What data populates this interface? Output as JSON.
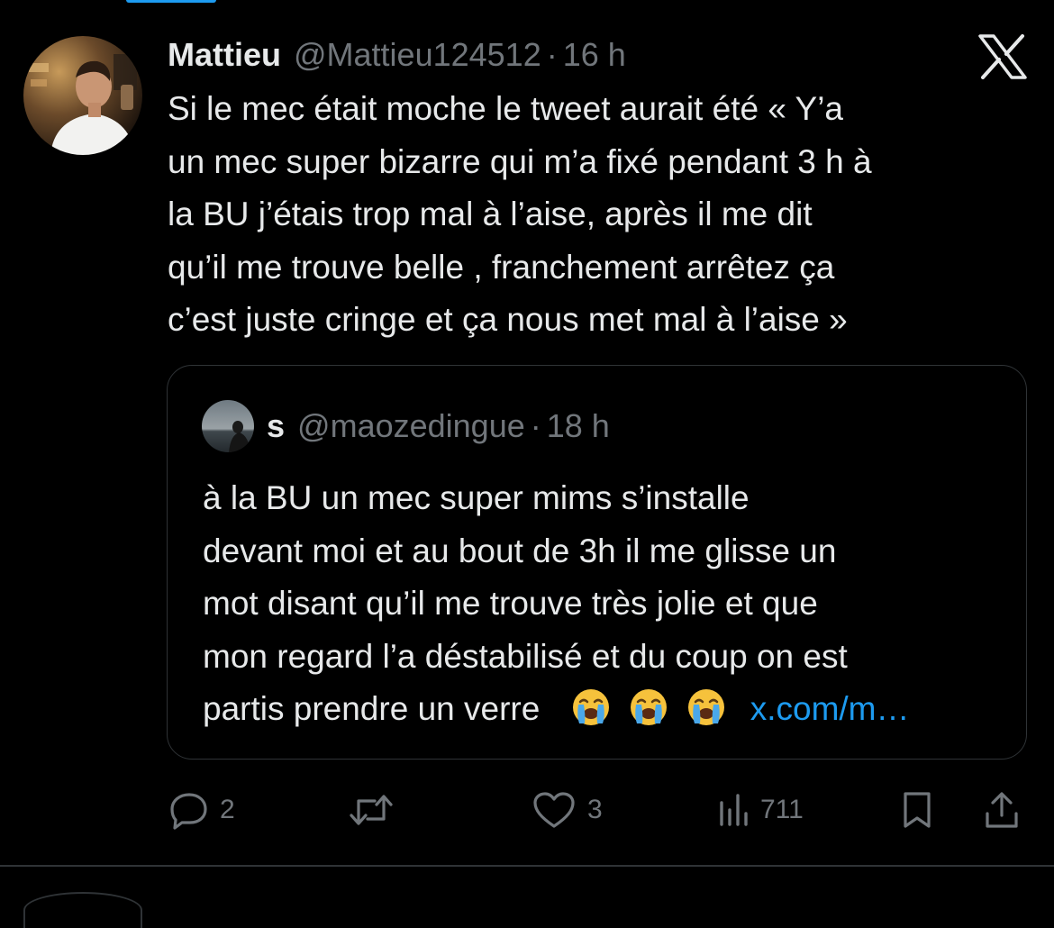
{
  "tweet": {
    "author_name": "Mattieu",
    "author_handle": "@Mattieu124512",
    "separator": "·",
    "time": "16 h",
    "text_lines": [
      "Si le mec était moche le tweet aurait été « Y’a",
      "un mec super bizarre qui m’a fixé pendant 3 h à",
      "la BU j’étais trop mal à l’aise, après il me dit",
      "qu’il me trouve belle , franchement arrêtez ça",
      "c’est juste cringe et ça nous met mal à l’aise »"
    ]
  },
  "quote": {
    "author_name": "s",
    "author_handle": "@maozedingue",
    "separator": "·",
    "time": "18 h",
    "text_lines": [
      "à la BU un mec super mims  s’installe",
      "devant moi et au bout de 3h il me glisse un",
      "mot disant qu’il me trouve très jolie et que",
      "mon regard l’a déstabilisé et du coup on est"
    ],
    "last_line_text": "partis prendre un verre",
    "emoji": [
      "loudly-crying-face",
      "loudly-crying-face",
      "loudly-crying-face"
    ],
    "link_text": "x.com/m…"
  },
  "actions": {
    "replies": "2",
    "retweets": "",
    "likes": "3",
    "views": "711"
  },
  "icons": {
    "close": "x-logo-icon",
    "reply": "reply-icon",
    "retweet": "retweet-icon",
    "like": "heart-icon",
    "views": "views-chart-icon",
    "bookmark": "bookmark-icon",
    "share": "share-icon"
  },
  "colors": {
    "background": "#000000",
    "text": "#e7e9ea",
    "secondary": "#71767b",
    "link": "#1d9bf0",
    "border": "#2f3336"
  }
}
